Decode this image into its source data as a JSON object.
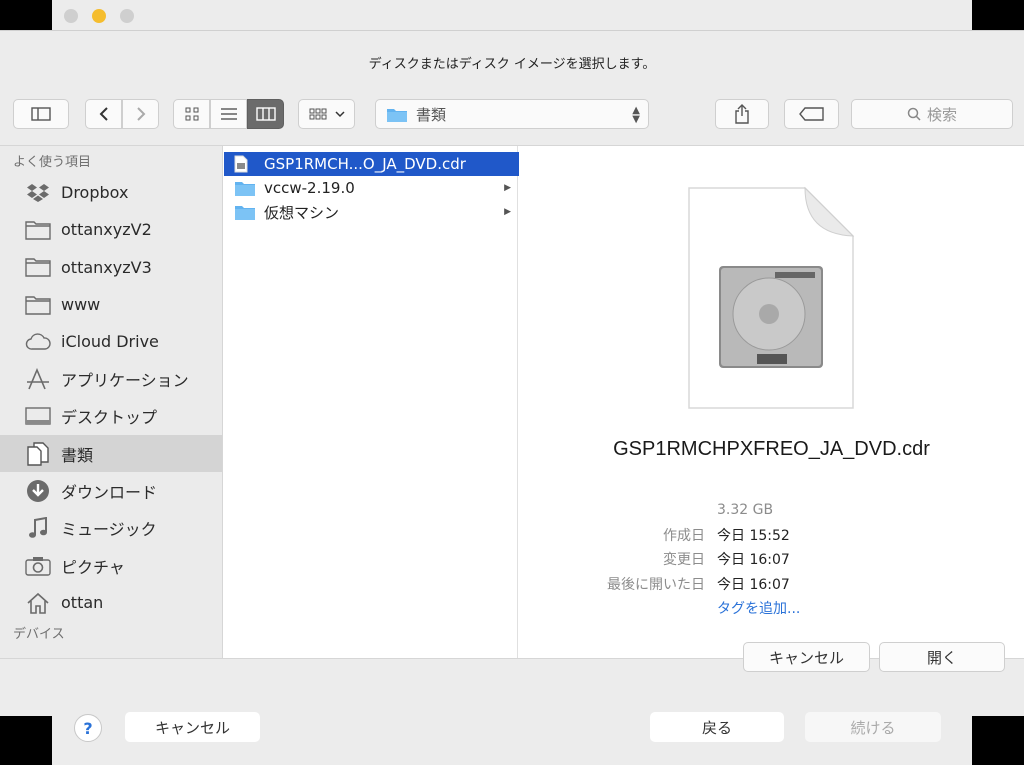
{
  "window": {
    "prompt": "ディスクまたはディスク イメージを選択します。"
  },
  "toolbar": {
    "path_folder": "書類",
    "search_placeholder": "検索"
  },
  "sidebar": {
    "favorites_heading": "よく使う項目",
    "devices_heading": "デバイス",
    "items": [
      {
        "label": "Dropbox",
        "icon": "dropbox-icon"
      },
      {
        "label": "ottanxyzV2",
        "icon": "folder-icon"
      },
      {
        "label": "ottanxyzV3",
        "icon": "folder-icon"
      },
      {
        "label": "www",
        "icon": "folder-icon"
      },
      {
        "label": "iCloud Drive",
        "icon": "cloud-icon"
      },
      {
        "label": "アプリケーション",
        "icon": "applications-icon"
      },
      {
        "label": "デスクトップ",
        "icon": "desktop-icon"
      },
      {
        "label": "書類",
        "icon": "documents-icon",
        "selected": true
      },
      {
        "label": "ダウンロード",
        "icon": "download-icon"
      },
      {
        "label": "ミュージック",
        "icon": "music-icon"
      },
      {
        "label": "ピクチャ",
        "icon": "camera-icon"
      },
      {
        "label": "ottan",
        "icon": "home-icon"
      }
    ]
  },
  "column": {
    "rows": [
      {
        "label": "GSP1RMCH...O_JA_DVD.cdr",
        "type": "file",
        "selected": true
      },
      {
        "label": "vccw-2.19.0",
        "type": "folder"
      },
      {
        "label": "仮想マシン",
        "type": "folder"
      }
    ]
  },
  "preview": {
    "filename": "GSP1RMCHPXFREO_JA_DVD.cdr",
    "size": "3.32 GB",
    "created_label": "作成日",
    "created_value": "今日 15:52",
    "modified_label": "変更日",
    "modified_value": "今日 16:07",
    "opened_label": "最後に開いた日",
    "opened_value": "今日 16:07",
    "add_tags": "タグを追加..."
  },
  "dialog_buttons": {
    "cancel": "キャンセル",
    "open": "開く"
  },
  "background_window": {
    "cancel": "キャンセル",
    "back": "戻る",
    "continue": "続ける",
    "help": "?"
  },
  "colors": {
    "selection_blue": "#2058c9",
    "link_blue": "#2a72d8",
    "minimize_yellow": "#f5bd2e"
  }
}
